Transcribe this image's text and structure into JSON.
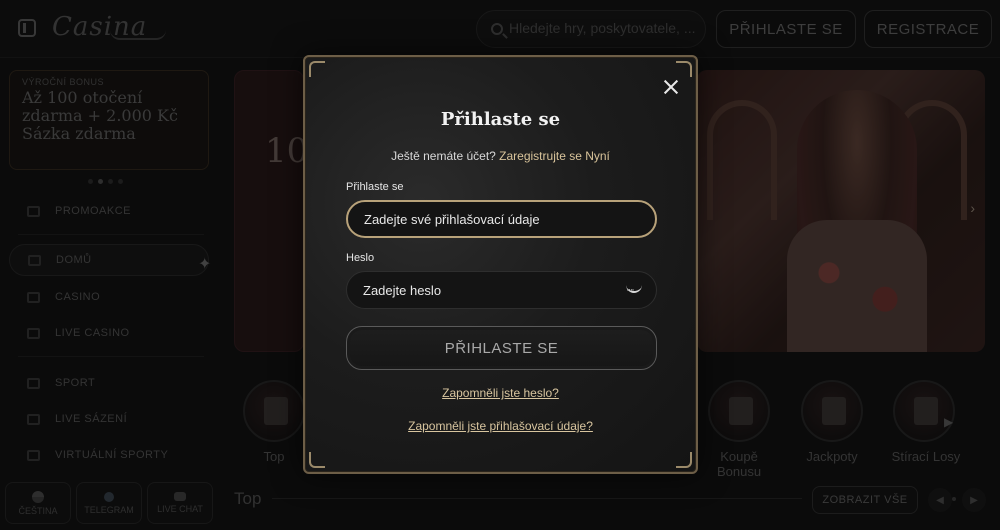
{
  "header": {
    "logo": "Casina",
    "search_placeholder": "Hledejte hry, poskytovatele, ...",
    "login_label": "PŘIHLASTE SE",
    "register_label": "REGISTRACE"
  },
  "sidebar": {
    "promo": {
      "kicker": "VÝROČNÍ BONUS",
      "title": "Až 100 otočení zdarma + 2.000 Kč Sázka zdarma"
    },
    "items": [
      {
        "label": "PROMOAKCE"
      },
      {
        "label": "DOMŮ"
      },
      {
        "label": "CASINO"
      },
      {
        "label": "LIVE CASINO"
      },
      {
        "label": "SPORT"
      },
      {
        "label": "LIVE SÁZENÍ"
      },
      {
        "label": "VIRTUÁLNÍ SPORTY"
      }
    ],
    "bottom_tabs": [
      {
        "label": "ČEŠTINA"
      },
      {
        "label": "TELEGRAM"
      },
      {
        "label": "LIVE CHAT"
      }
    ]
  },
  "main": {
    "hero_number": "10",
    "categories": [
      {
        "label": "Top"
      },
      {
        "label": "Koupě Bonusu"
      },
      {
        "label": "Jackpoty"
      },
      {
        "label": "Stírací Losy"
      }
    ],
    "section_title": "Top",
    "show_all_label": "ZOBRAZIT VŠE"
  },
  "modal": {
    "title": "Přihlaste se",
    "no_account_text": "Ještě nemáte účet?",
    "register_link": "Zaregistrujte se Nyní",
    "login_label": "Přihlaste se",
    "login_placeholder": "Zadejte své přihlašovací údaje",
    "password_label": "Heslo",
    "password_placeholder": "Zadejte heslo",
    "submit_label": "PŘIHLASTE SE",
    "forgot_password": "Zapomněli jste heslo?",
    "forgot_credentials": "Zapomněli jste přihlašovací údaje?"
  },
  "colors": {
    "accent_gold": "#d9c49b",
    "modal_border": "#6d5e47",
    "background": "#141414"
  }
}
